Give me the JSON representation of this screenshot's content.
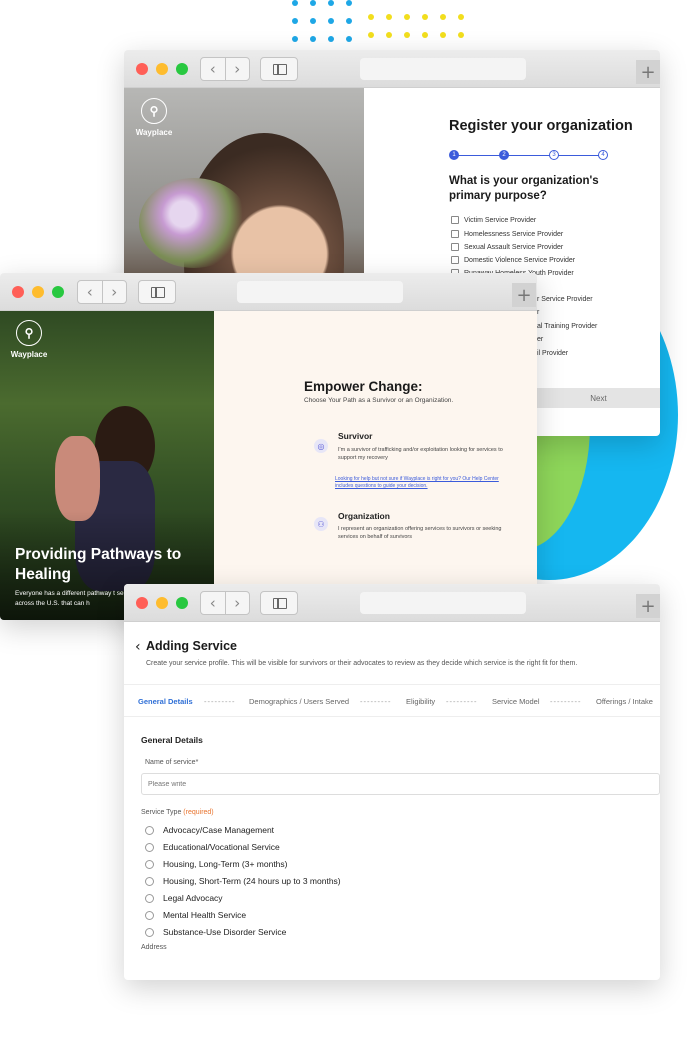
{
  "decor": {
    "dot_blue": "#1ea7e6",
    "dot_yellow": "#f2de1d",
    "circle_blue": "#15b7f0",
    "circle_green": "#8ed65a"
  },
  "register": {
    "title": "Register your organization",
    "steps": [
      "1",
      "2",
      "3",
      "4"
    ],
    "question": "What is your organization's primary purpose?",
    "options": [
      "Victim Service Provider",
      "Homelessness Service Provider",
      "Sexual Assault Service Provider",
      "Domestic Violence Service Provider",
      "Runaway Homeless Youth Provider",
      "r Service Provider",
      "r",
      "al Training Provider",
      "er",
      "il Provider"
    ],
    "next_label": "Next",
    "logo_text": "Wayplace"
  },
  "empower": {
    "logo_text": "Wayplace",
    "title": "Empower Change:",
    "subtitle": "Choose Your Path as a Survivor or an Organization.",
    "survivor_title": "Survivor",
    "survivor_desc": "I'm a survivor of trafficking and/or exploitation looking for services to support my recovery",
    "survivor_link": "Looking for help but not sure if Wayplace is right for you? Our Help Center includes questions to guide your decision.",
    "org_title": "Organization",
    "org_desc": "I represent an organization offering services to survivors or seeking services on behalf of survivors",
    "hero_title": "Providing Pathways to Healing",
    "hero_text": "Everyone has a different pathway t services across the U.S. that can h"
  },
  "service": {
    "back_icon": "chevron-left-icon",
    "title": "Adding Service",
    "subtitle": "Create your service profile. This will be visible for survivors or their advocates to review as they decide which service is the right fit for them.",
    "tabs": [
      "General Details",
      "Demographics / Users Served",
      "Eligibility",
      "Service Model",
      "Offerings / Intake"
    ],
    "tab_sep": "---------",
    "section_title": "General Details",
    "name_label": "Name of service*",
    "name_placeholder": "Please write",
    "type_label": "Service Type",
    "required_tag": "(required)",
    "types": [
      "Advocacy/Case Management",
      "Educational/Vocational Service",
      "Housing, Long-Term (3+ months)",
      "Housing, Short-Term (24 hours up to 3 months)",
      "Legal Advocacy",
      "Mental Health Service",
      "Substance-Use Disorder Service"
    ],
    "address_label": "Address"
  }
}
